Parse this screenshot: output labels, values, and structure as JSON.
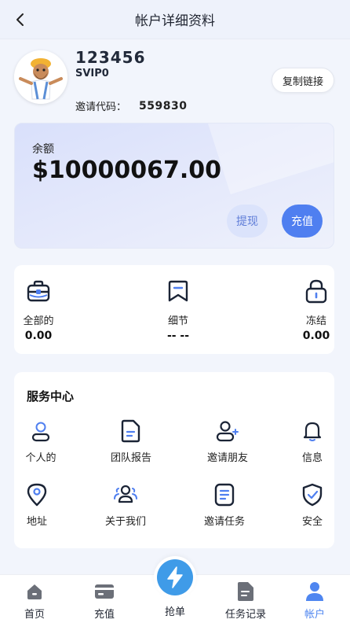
{
  "header": {
    "title": "帐户详细资料"
  },
  "profile": {
    "username": "123456",
    "level": "SVIP0",
    "invite_label": "邀请代码：",
    "invite_code": "559830",
    "copy_label": "复制链接"
  },
  "balance": {
    "label": "余额",
    "amount": "$10000067.00",
    "withdraw_label": "提现",
    "deposit_label": "充值"
  },
  "stats": [
    {
      "label": "全部的",
      "value": "0.00",
      "icon": "briefcase-icon"
    },
    {
      "label": "细节",
      "value": "-- --",
      "icon": "bookmark-icon"
    },
    {
      "label": "冻结",
      "value": "0.00",
      "icon": "lock-icon"
    }
  ],
  "services": {
    "title": "服务中心",
    "items": [
      {
        "label": "个人的",
        "icon": "user-icon"
      },
      {
        "label": "团队报告",
        "icon": "document-icon"
      },
      {
        "label": "邀请朋友",
        "icon": "add-user-icon"
      },
      {
        "label": "信息",
        "icon": "bell-icon"
      },
      {
        "label": "地址",
        "icon": "location-pin-icon"
      },
      {
        "label": "关于我们",
        "icon": "group-icon"
      },
      {
        "label": "邀请任务",
        "icon": "task-list-icon"
      },
      {
        "label": "安全",
        "icon": "shield-icon"
      }
    ]
  },
  "tabbar": {
    "items": [
      {
        "label": "首页",
        "icon": "home-icon"
      },
      {
        "label": "充值",
        "icon": "card-icon"
      },
      {
        "label": "抢单",
        "icon": "lightning-icon"
      },
      {
        "label": "任务记录",
        "icon": "record-icon"
      },
      {
        "label": "帐户",
        "icon": "account-icon"
      }
    ]
  },
  "colors": {
    "accent": "#4f7ff0",
    "active_tab": "#4f86f0",
    "grab_button": "#3f9be8"
  }
}
